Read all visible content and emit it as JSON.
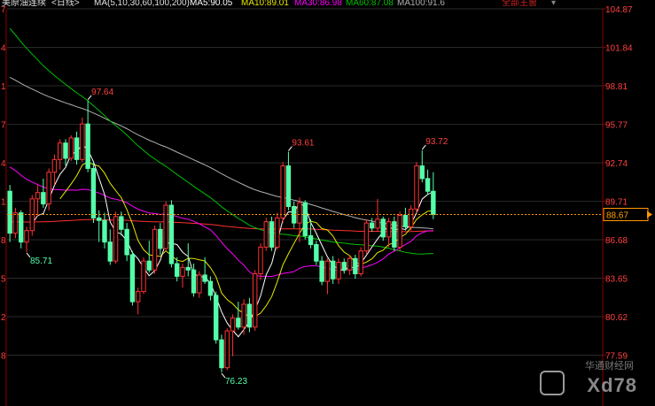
{
  "header": {
    "symbol": "美原油连续",
    "period": "<日线>",
    "ma_params": "MA(5,10,30,60,100,200)",
    "ma5": "MA5:90.05",
    "ma10": "MA10:89.01",
    "ma30": "MA30:86.98",
    "ma60": "MA60:87.08",
    "ma100": "MA100:91.6",
    "dropdown": "全部主窗"
  },
  "colors": {
    "up": "#ff3232",
    "down": "#54ffaa",
    "ma5": "#ffffff",
    "ma10": "#e8e800",
    "ma30": "#ff00ff",
    "ma60": "#00c000",
    "ma100": "#b0b0b0",
    "ma200": "#ff3030",
    "axis_text": "#ff4040",
    "grid": "#2a2a2a",
    "price_line": "#ff9900"
  },
  "left_axis_labels": [
    "7",
    "4",
    "1",
    "7",
    "4",
    "1",
    "8",
    "5",
    "2",
    "8"
  ],
  "chart_data": {
    "type": "candlestick",
    "ylim": [
      74.56,
      104.87
    ],
    "yticks": [
      104.87,
      101.84,
      98.81,
      95.77,
      92.74,
      89.71,
      86.68,
      83.65,
      80.62,
      77.59
    ],
    "ytick_labels": [
      "104.87",
      "101.84",
      "98.81",
      "95.77",
      "92.74",
      "89.71",
      "86.68",
      "83.65",
      "80.62",
      "77.59"
    ],
    "current_price": 88.67,
    "current_price_label": "88.67",
    "annotations": [
      {
        "text": "97.64",
        "index": 14,
        "value": 97.64,
        "kind": "high"
      },
      {
        "text": "85.71",
        "index": 3,
        "value": 85.71,
        "kind": "low"
      },
      {
        "text": "76.23",
        "index": 38,
        "value": 76.23,
        "kind": "low"
      },
      {
        "text": "93.61",
        "index": 50,
        "value": 93.61,
        "kind": "high"
      },
      {
        "text": "93.72",
        "index": 74,
        "value": 93.72,
        "kind": "high"
      }
    ],
    "candles": [
      [
        90.5,
        91.0,
        86.5,
        87.2
      ],
      [
        87.2,
        89.2,
        86.8,
        88.8
      ],
      [
        88.8,
        89.0,
        86.0,
        86.5
      ],
      [
        86.5,
        87.7,
        85.71,
        87.4
      ],
      [
        87.4,
        90.2,
        87.0,
        89.9
      ],
      [
        89.9,
        91.0,
        88.5,
        90.4
      ],
      [
        90.4,
        91.5,
        89.2,
        89.5
      ],
      [
        89.5,
        92.3,
        89.0,
        92.0
      ],
      [
        92.0,
        93.4,
        91.0,
        93.0
      ],
      [
        93.0,
        94.6,
        92.2,
        94.3
      ],
      [
        94.3,
        94.6,
        92.5,
        93.1
      ],
      [
        93.1,
        94.9,
        92.9,
        94.7
      ],
      [
        94.7,
        95.2,
        92.6,
        93.0
      ],
      [
        93.0,
        96.3,
        92.8,
        95.8
      ],
      [
        95.8,
        97.64,
        92.0,
        92.3
      ],
      [
        92.3,
        92.8,
        88.0,
        88.4
      ],
      [
        88.4,
        89.0,
        86.5,
        88.2
      ],
      [
        88.2,
        88.8,
        86.0,
        86.5
      ],
      [
        86.5,
        87.5,
        84.7,
        85.0
      ],
      [
        85.0,
        88.9,
        84.8,
        88.5
      ],
      [
        88.5,
        88.9,
        87.0,
        87.5
      ],
      [
        87.5,
        88.0,
        85.0,
        85.5
      ],
      [
        85.5,
        85.8,
        81.5,
        81.8
      ],
      [
        81.8,
        82.9,
        80.8,
        82.6
      ],
      [
        82.6,
        85.3,
        82.4,
        85.0
      ],
      [
        85.0,
        86.6,
        84.1,
        84.3
      ],
      [
        84.3,
        87.8,
        84.0,
        87.5
      ],
      [
        87.5,
        88.0,
        85.5,
        86.0
      ],
      [
        86.0,
        89.7,
        85.8,
        89.4
      ],
      [
        89.4,
        89.8,
        84.5,
        84.8
      ],
      [
        84.8,
        85.3,
        83.4,
        83.8
      ],
      [
        83.8,
        84.8,
        82.9,
        84.5
      ],
      [
        84.5,
        86.4,
        83.8,
        84.3
      ],
      [
        84.3,
        84.8,
        82.2,
        82.5
      ],
      [
        82.5,
        84.2,
        82.1,
        83.9
      ],
      [
        83.9,
        85.3,
        83.2,
        83.4
      ],
      [
        83.4,
        83.8,
        81.9,
        82.3
      ],
      [
        82.3,
        82.6,
        78.5,
        78.8
      ],
      [
        78.8,
        79.2,
        76.23,
        76.6
      ],
      [
        76.6,
        79.7,
        76.4,
        79.5
      ],
      [
        79.5,
        80.8,
        77.5,
        80.5
      ],
      [
        80.5,
        81.8,
        79.6,
        79.8
      ],
      [
        79.8,
        82.0,
        79.2,
        81.6
      ],
      [
        81.6,
        82.1,
        79.4,
        79.8
      ],
      [
        79.8,
        84.3,
        79.5,
        84.0
      ],
      [
        84.0,
        86.4,
        83.5,
        86.1
      ],
      [
        86.1,
        88.4,
        85.8,
        88.1
      ],
      [
        88.1,
        88.5,
        85.8,
        86.1
      ],
      [
        86.1,
        88.8,
        85.9,
        88.4
      ],
      [
        88.4,
        92.8,
        88.0,
        92.5
      ],
      [
        92.5,
        93.61,
        89.0,
        89.3
      ],
      [
        89.3,
        89.7,
        87.6,
        88.0
      ],
      [
        88.0,
        90.0,
        86.5,
        89.6
      ],
      [
        89.6,
        89.8,
        86.7,
        87.0
      ],
      [
        87.0,
        88.3,
        86.0,
        86.3
      ],
      [
        86.3,
        86.6,
        84.7,
        85.0
      ],
      [
        85.0,
        85.4,
        83.1,
        83.4
      ],
      [
        83.4,
        85.2,
        82.4,
        85.0
      ],
      [
        85.0,
        85.4,
        83.2,
        83.6
      ],
      [
        83.6,
        85.2,
        83.2,
        84.9
      ],
      [
        84.9,
        85.2,
        84.0,
        84.3
      ],
      [
        84.3,
        85.5,
        83.9,
        85.2
      ],
      [
        85.2,
        85.5,
        83.6,
        84.0
      ],
      [
        84.0,
        86.1,
        83.8,
        85.8
      ],
      [
        85.8,
        88.3,
        85.5,
        88.0
      ],
      [
        88.0,
        88.4,
        87.3,
        87.6
      ],
      [
        87.6,
        89.9,
        87.3,
        88.3
      ],
      [
        88.3,
        88.5,
        86.6,
        86.9
      ],
      [
        86.9,
        88.4,
        86.1,
        88.1
      ],
      [
        88.1,
        88.5,
        85.8,
        86.1
      ],
      [
        86.1,
        88.9,
        85.8,
        88.6
      ],
      [
        88.6,
        89.2,
        87.4,
        87.7
      ],
      [
        87.7,
        89.4,
        87.4,
        89.1
      ],
      [
        89.1,
        92.8,
        88.8,
        92.5
      ],
      [
        92.5,
        93.72,
        91.2,
        91.5
      ],
      [
        91.5,
        92.2,
        90.2,
        90.5
      ],
      [
        90.5,
        92.0,
        88.3,
        88.67
      ]
    ]
  }
}
